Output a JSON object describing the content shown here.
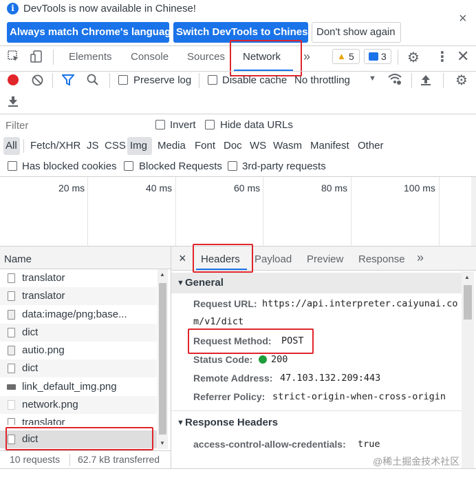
{
  "banner": {
    "info_icon": "info-icon",
    "message": "DevTools is now available in Chinese!",
    "btn_match": "Always match Chrome's language",
    "btn_switch": "Switch DevTools to Chinese",
    "btn_dont": "Don't show again",
    "close": "×"
  },
  "tabs": {
    "elements": "Elements",
    "console": "Console",
    "sources": "Sources",
    "network": "Network",
    "more": "»",
    "warn_count": "5",
    "msg_count": "3"
  },
  "toolbar": {
    "preserve_log": "Preserve log",
    "disable_cache": "Disable cache",
    "throttling": "No throttling"
  },
  "filter": {
    "placeholder": "Filter",
    "invert": "Invert",
    "hide_data_urls": "Hide data URLs",
    "types": [
      "All",
      "Fetch/XHR",
      "JS",
      "CSS",
      "Img",
      "Media",
      "Font",
      "Doc",
      "WS",
      "Wasm",
      "Manifest",
      "Other"
    ],
    "blocked_cookies": "Has blocked cookies",
    "blocked_requests": "Blocked Requests",
    "third_party": "3rd-party requests"
  },
  "timeline": {
    "ticks": [
      "20 ms",
      "40 ms",
      "60 ms",
      "80 ms",
      "100 ms"
    ]
  },
  "requests": {
    "header": "Name",
    "items": [
      "translator",
      "translator",
      "data:image/png;base...",
      "dict",
      "autio.png",
      "dict",
      "link_default_img.png",
      "network.png",
      "translator",
      "dict"
    ],
    "summary_count": "10 requests",
    "summary_size": "62.7 kB transferred"
  },
  "detail": {
    "close": "×",
    "tabs": [
      "Headers",
      "Payload",
      "Preview",
      "Response"
    ],
    "more": "»",
    "general_title": "General",
    "request_url_key": "Request URL:",
    "request_url_val1": "https://api.interpreter.caiyunai.co",
    "request_url_val2": "m/v1/dict",
    "method_key": "Request Method:",
    "method_val": "POST",
    "status_key": "Status Code:",
    "status_val": "200",
    "status_color": "#1e9e3a",
    "remote_key": "Remote Address:",
    "remote_val": "47.103.132.209:443",
    "referrer_key": "Referrer Policy:",
    "referrer_val": "strict-origin-when-cross-origin",
    "response_title": "Response Headers",
    "acac_key": "access-control-allow-credentials:",
    "acac_val": "true"
  },
  "watermark": "@稀土掘金技术社区",
  "colors": {
    "accent": "#1a73e8",
    "highlight": "#e0252b",
    "record": "#e0252b"
  }
}
